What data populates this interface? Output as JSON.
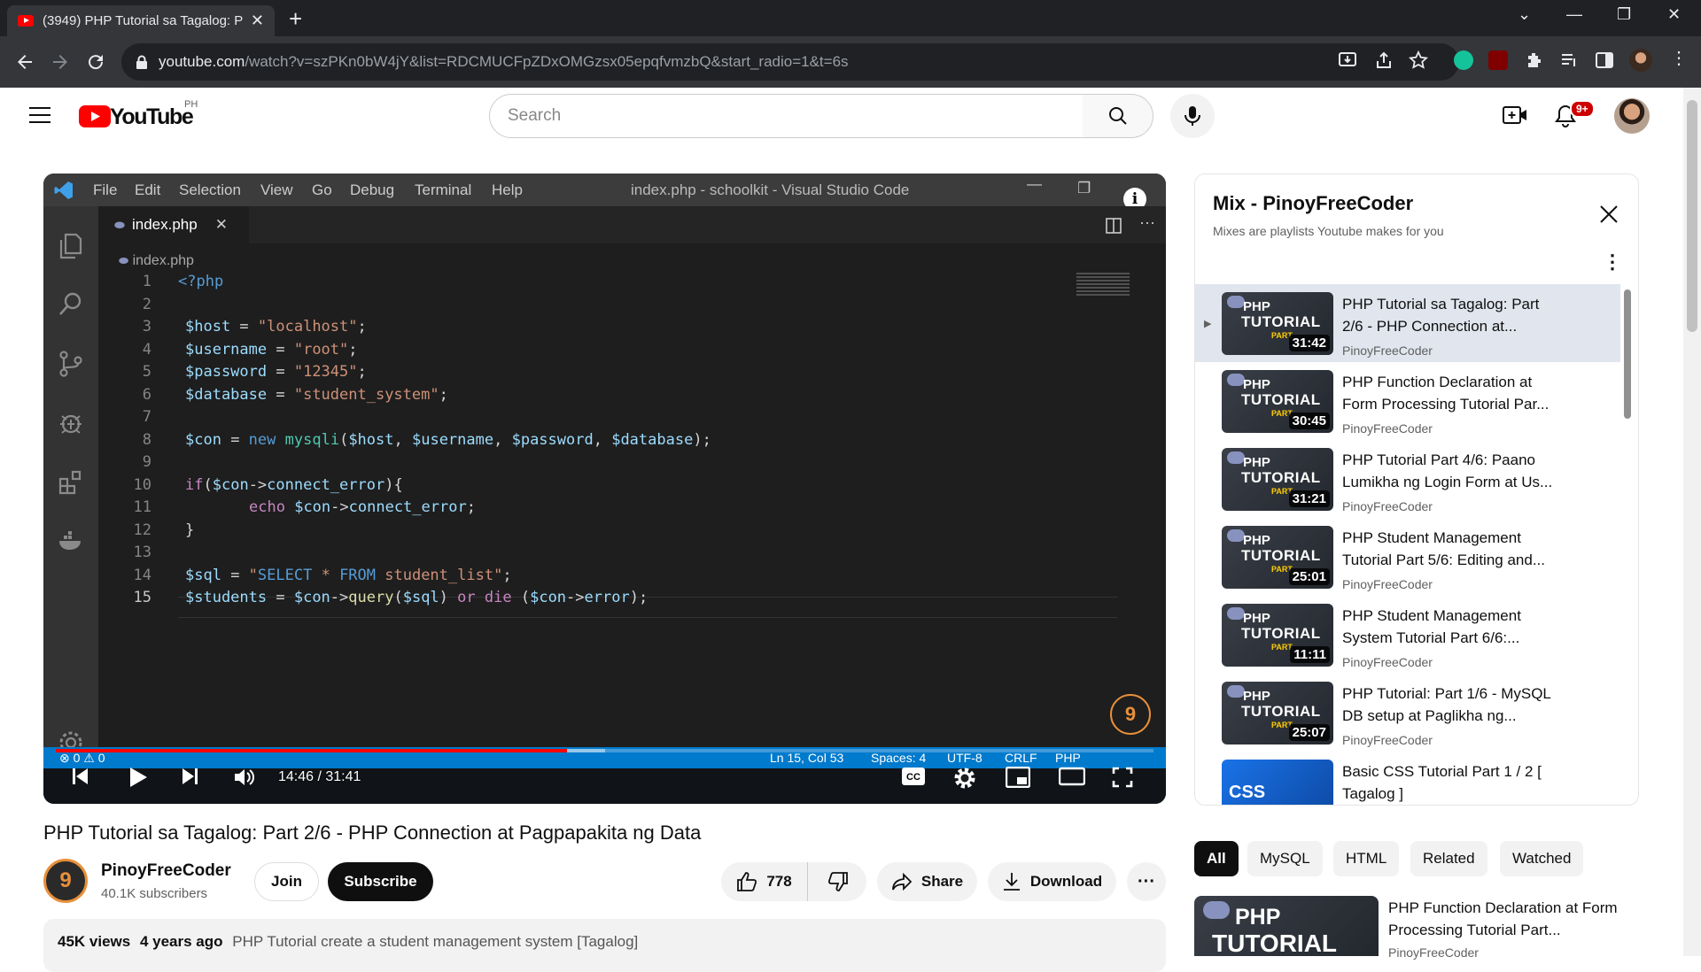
{
  "browser": {
    "tab_title": "(3949) PHP Tutorial sa Tagalog: P",
    "url_host": "youtube.com",
    "url_rest": "/watch?v=szPKn0bW4jY&list=RDCMUCFpZDxOMGzsx05epqfvmzbQ&start_radio=1&t=6s"
  },
  "header": {
    "logo": "YouTube",
    "country": "PH",
    "search_placeholder": "Search",
    "notifications": "9+"
  },
  "player": {
    "vscode": {
      "menu": [
        "File",
        "Edit",
        "Selection",
        "View",
        "Go",
        "Debug",
        "Terminal",
        "Help"
      ],
      "window_title": "index.php - schoolkit - Visual Studio Code",
      "tab": "index.php",
      "breadcrumb": "index.php",
      "status": {
        "problems": "⊗ 0 ⚠ 0",
        "position": "Ln 15, Col 53",
        "spaces": "Spaces: 4",
        "encoding": "UTF-8",
        "eol": "CRLF",
        "lang": "PHP"
      },
      "line_numbers": [
        "1",
        "2",
        "3",
        "4",
        "5",
        "6",
        "7",
        "8",
        "9",
        "10",
        "11",
        "12",
        "13",
        "14",
        "15"
      ]
    },
    "time": "14:46 / 31:41",
    "progress": 0.466,
    "buffered": 0.5
  },
  "video": {
    "title": "PHP Tutorial sa Tagalog: Part 2/6 - PHP Connection at Pagpapakita ng Data",
    "channel": "PinoyFreeCoder",
    "subscribers": "40.1K subscribers",
    "join": "Join",
    "subscribe": "Subscribe",
    "likes": "778",
    "share": "Share",
    "download": "Download",
    "views": "45K views",
    "age": "4 years ago",
    "description": "PHP Tutorial create a student management system [Tagalog]"
  },
  "playlist": {
    "title": "Mix - PinoyFreeCoder",
    "subtitle": "Mixes are playlists Youtube makes for you",
    "items": [
      {
        "title": "PHP Tutorial sa Tagalog: Part 2/6 - PHP Connection at...",
        "channel": "PinoyFreeCoder",
        "duration": "31:42"
      },
      {
        "title": "PHP Function Declaration at Form Processing Tutorial Par...",
        "channel": "PinoyFreeCoder",
        "duration": "30:45"
      },
      {
        "title": "PHP Tutorial Part 4/6: Paano Lumikha ng Login Form at Us...",
        "channel": "PinoyFreeCoder",
        "duration": "31:21"
      },
      {
        "title": "PHP Student Management Tutorial Part 5/6: Editing and...",
        "channel": "PinoyFreeCoder",
        "duration": "25:01"
      },
      {
        "title": "PHP Student Management System Tutorial Part 6/6:...",
        "channel": "PinoyFreeCoder",
        "duration": "11:11"
      },
      {
        "title": "PHP Tutorial: Part 1/6 - MySQL DB setup at Paglikha ng...",
        "channel": "PinoyFreeCoder",
        "duration": "25:07"
      },
      {
        "title": "Basic CSS Tutorial Part 1 / 2 [ Tagalog ]",
        "channel": "",
        "duration": ""
      }
    ],
    "thumb_php": "PHP",
    "thumb_tutorial": "TUTORIAL",
    "thumb_part": "PART"
  },
  "chips": [
    "All",
    "MySQL",
    "HTML",
    "Related",
    "Watched"
  ],
  "recommended": {
    "title": "PHP Function Declaration at Form Processing Tutorial Part...",
    "channel": "PinoyFreeCoder"
  }
}
